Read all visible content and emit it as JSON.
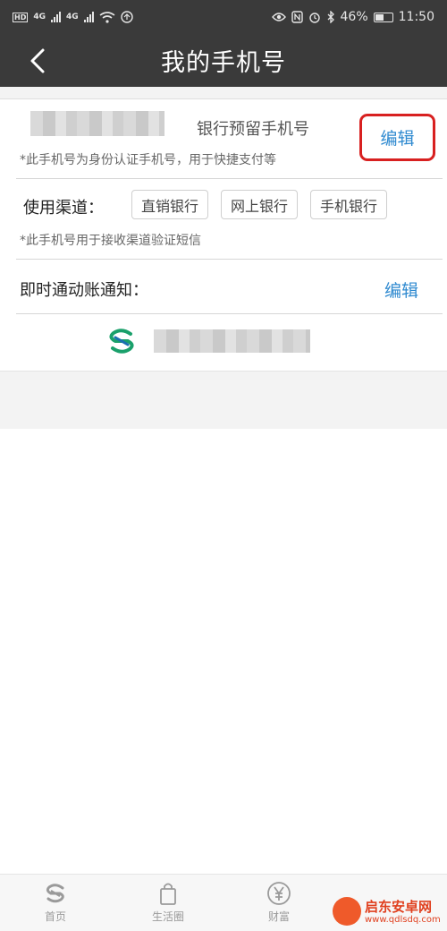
{
  "status_bar": {
    "network1": "4G",
    "network2": "4G",
    "battery": "46%",
    "time": "11:50",
    "icons": [
      "hd-icon",
      "signal-icon",
      "signal-icon",
      "wifi-icon",
      "sync-icon",
      "eye-icon",
      "nfc-icon",
      "alarm-icon",
      "bluetooth-icon",
      "battery-icon"
    ]
  },
  "header": {
    "title": "我的手机号",
    "back_icon": "chevron-left-icon"
  },
  "reserved_phone": {
    "label": "银行预留手机号",
    "edit": "编辑",
    "note": "*此手机号为身份认证手机号，用于快捷支付等"
  },
  "channels": {
    "label": "使用渠道：",
    "items": [
      "直销银行",
      "网上银行",
      "手机银行"
    ],
    "note": "*此手机号用于接收渠道验证短信"
  },
  "notification": {
    "label": "即时通动账通知：",
    "edit": "编辑"
  },
  "nav": {
    "items": [
      {
        "label": "首页",
        "icon": "bank-logo-icon"
      },
      {
        "label": "生活圈",
        "icon": "shopping-bag-icon"
      },
      {
        "label": "财富",
        "icon": "yuan-icon"
      }
    ]
  },
  "watermark": {
    "title": "启东安卓网",
    "url": "www.qdlsdq.com"
  },
  "colors": {
    "header_bg": "#3a3a3a",
    "link": "#2f8ad0",
    "highlight": "#d82020",
    "logo": "#1aa06b"
  }
}
